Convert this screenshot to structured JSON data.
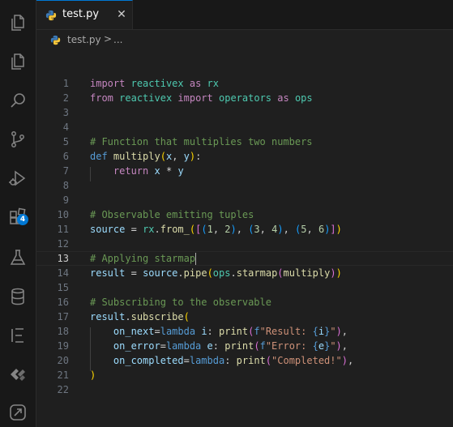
{
  "tab": {
    "label": "test.py",
    "close": "✕"
  },
  "breadcrumb": {
    "file": "test.py",
    "separator": ">",
    "more": "..."
  },
  "activity": {
    "badge_count": "4"
  },
  "colors": {
    "keyword": "#c586c0",
    "def": "#569cd6",
    "module": "#4ec9b0",
    "function": "#dcdcaa",
    "variable": "#9cdcfe",
    "number": "#b5cea8",
    "string": "#ce9178",
    "comment": "#6a9955",
    "accent": "#0078d4"
  },
  "current_line": "13",
  "lines": [
    {
      "n": "1",
      "tokens": [
        [
          "kw",
          "import"
        ],
        [
          "p",
          " "
        ],
        [
          "mod",
          "reactivex"
        ],
        [
          "p",
          " "
        ],
        [
          "kw",
          "as"
        ],
        [
          "p",
          " "
        ],
        [
          "mod",
          "rx"
        ]
      ]
    },
    {
      "n": "2",
      "tokens": [
        [
          "kw",
          "from"
        ],
        [
          "p",
          " "
        ],
        [
          "mod",
          "reactivex"
        ],
        [
          "p",
          " "
        ],
        [
          "kw",
          "import"
        ],
        [
          "p",
          " "
        ],
        [
          "mod",
          "operators"
        ],
        [
          "p",
          " "
        ],
        [
          "kw",
          "as"
        ],
        [
          "p",
          " "
        ],
        [
          "mod",
          "ops"
        ]
      ]
    },
    {
      "n": "3",
      "tokens": []
    },
    {
      "n": "4",
      "tokens": []
    },
    {
      "n": "5",
      "tokens": [
        [
          "com",
          "# Function that multiplies two numbers"
        ]
      ]
    },
    {
      "n": "6",
      "tokens": [
        [
          "def",
          "def"
        ],
        [
          "p",
          " "
        ],
        [
          "fn",
          "multiply"
        ],
        [
          "b1",
          "("
        ],
        [
          "var",
          "x"
        ],
        [
          "p",
          ", "
        ],
        [
          "var",
          "y"
        ],
        [
          "b1",
          ")"
        ],
        [
          "p",
          ":"
        ]
      ]
    },
    {
      "n": "7",
      "tokens": [
        [
          "p",
          "    "
        ],
        [
          "kw",
          "return"
        ],
        [
          "p",
          " "
        ],
        [
          "var",
          "x"
        ],
        [
          "p",
          " "
        ],
        [
          "op",
          "*"
        ],
        [
          "p",
          " "
        ],
        [
          "var",
          "y"
        ]
      ]
    },
    {
      "n": "8",
      "tokens": []
    },
    {
      "n": "9",
      "tokens": []
    },
    {
      "n": "10",
      "tokens": [
        [
          "com",
          "# Observable emitting tuples"
        ]
      ]
    },
    {
      "n": "11",
      "tokens": [
        [
          "var",
          "source"
        ],
        [
          "p",
          " "
        ],
        [
          "op",
          "="
        ],
        [
          "p",
          " "
        ],
        [
          "mod",
          "rx"
        ],
        [
          "p",
          "."
        ],
        [
          "fn",
          "from_"
        ],
        [
          "b1",
          "("
        ],
        [
          "b2",
          "["
        ],
        [
          "b3",
          "("
        ],
        [
          "num",
          "1"
        ],
        [
          "p",
          ", "
        ],
        [
          "num",
          "2"
        ],
        [
          "b3",
          ")"
        ],
        [
          "p",
          ", "
        ],
        [
          "b3",
          "("
        ],
        [
          "num",
          "3"
        ],
        [
          "p",
          ", "
        ],
        [
          "num",
          "4"
        ],
        [
          "b3",
          ")"
        ],
        [
          "p",
          ", "
        ],
        [
          "b3",
          "("
        ],
        [
          "num",
          "5"
        ],
        [
          "p",
          ", "
        ],
        [
          "num",
          "6"
        ],
        [
          "b3",
          ")"
        ],
        [
          "b2",
          "]"
        ],
        [
          "b1",
          ")"
        ]
      ]
    },
    {
      "n": "12",
      "tokens": []
    },
    {
      "n": "13",
      "tokens": [
        [
          "com",
          "# Applying starmap"
        ],
        [
          "cursor",
          ""
        ]
      ]
    },
    {
      "n": "14",
      "tokens": [
        [
          "var",
          "result"
        ],
        [
          "p",
          " "
        ],
        [
          "op",
          "="
        ],
        [
          "p",
          " "
        ],
        [
          "var",
          "source"
        ],
        [
          "p",
          "."
        ],
        [
          "fn",
          "pipe"
        ],
        [
          "b1",
          "("
        ],
        [
          "mod",
          "ops"
        ],
        [
          "p",
          "."
        ],
        [
          "fn",
          "starmap"
        ],
        [
          "b2",
          "("
        ],
        [
          "fn",
          "multiply"
        ],
        [
          "b2",
          ")"
        ],
        [
          "b1",
          ")"
        ]
      ]
    },
    {
      "n": "15",
      "tokens": []
    },
    {
      "n": "16",
      "tokens": [
        [
          "com",
          "# Subscribing to the observable"
        ]
      ]
    },
    {
      "n": "17",
      "tokens": [
        [
          "var",
          "result"
        ],
        [
          "p",
          "."
        ],
        [
          "fn",
          "subscribe"
        ],
        [
          "b1",
          "("
        ]
      ]
    },
    {
      "n": "18",
      "tokens": [
        [
          "p",
          "    "
        ],
        [
          "var",
          "on_next"
        ],
        [
          "op",
          "="
        ],
        [
          "def",
          "lambda"
        ],
        [
          "p",
          " "
        ],
        [
          "var",
          "i"
        ],
        [
          "p",
          ": "
        ],
        [
          "fn",
          "print"
        ],
        [
          "b2",
          "("
        ],
        [
          "def",
          "f"
        ],
        [
          "str",
          "\"Result: "
        ],
        [
          "def",
          "{"
        ],
        [
          "var",
          "i"
        ],
        [
          "def",
          "}"
        ],
        [
          "str",
          "\""
        ],
        [
          "b2",
          ")"
        ],
        [
          "p",
          ","
        ]
      ]
    },
    {
      "n": "19",
      "tokens": [
        [
          "p",
          "    "
        ],
        [
          "var",
          "on_error"
        ],
        [
          "op",
          "="
        ],
        [
          "def",
          "lambda"
        ],
        [
          "p",
          " "
        ],
        [
          "var",
          "e"
        ],
        [
          "p",
          ": "
        ],
        [
          "fn",
          "print"
        ],
        [
          "b2",
          "("
        ],
        [
          "def",
          "f"
        ],
        [
          "str",
          "\"Error: "
        ],
        [
          "def",
          "{"
        ],
        [
          "var",
          "e"
        ],
        [
          "def",
          "}"
        ],
        [
          "str",
          "\""
        ],
        [
          "b2",
          ")"
        ],
        [
          "p",
          ","
        ]
      ]
    },
    {
      "n": "20",
      "tokens": [
        [
          "p",
          "    "
        ],
        [
          "var",
          "on_completed"
        ],
        [
          "op",
          "="
        ],
        [
          "def",
          "lambda"
        ],
        [
          "p",
          ": "
        ],
        [
          "fn",
          "print"
        ],
        [
          "b2",
          "("
        ],
        [
          "str",
          "\"Completed!\""
        ],
        [
          "b2",
          ")"
        ],
        [
          "p",
          ","
        ]
      ]
    },
    {
      "n": "21",
      "tokens": [
        [
          "b1",
          ")"
        ]
      ]
    },
    {
      "n": "22",
      "tokens": []
    }
  ]
}
